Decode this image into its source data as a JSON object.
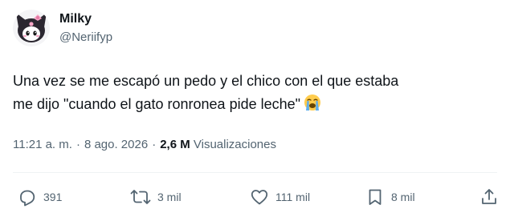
{
  "author": {
    "display_name": "Milky",
    "handle": "@Neriifyp",
    "avatar_icon": "kuromi-avatar-icon"
  },
  "tweet": {
    "text_line1": "Una vez se me escapó un pedo y el chico con el que estaba",
    "text_line2": "me dijo \"cuando el gato ronronea pide leche\"",
    "emoji": "loudly-crying-face-emoji"
  },
  "meta": {
    "time": "11:21 a. m.",
    "separator": "·",
    "date": "8 ago. 2026",
    "views_count": "2,6 M",
    "views_label": "Visualizaciones"
  },
  "actions": {
    "replies": "391",
    "reposts": "3 mil",
    "likes": "111 mil",
    "bookmarks": "8 mil"
  },
  "colors": {
    "text_primary": "#0f1419",
    "text_secondary": "#536471",
    "divider": "#eff3f4",
    "avatar_bow": "#f7a6c6"
  }
}
